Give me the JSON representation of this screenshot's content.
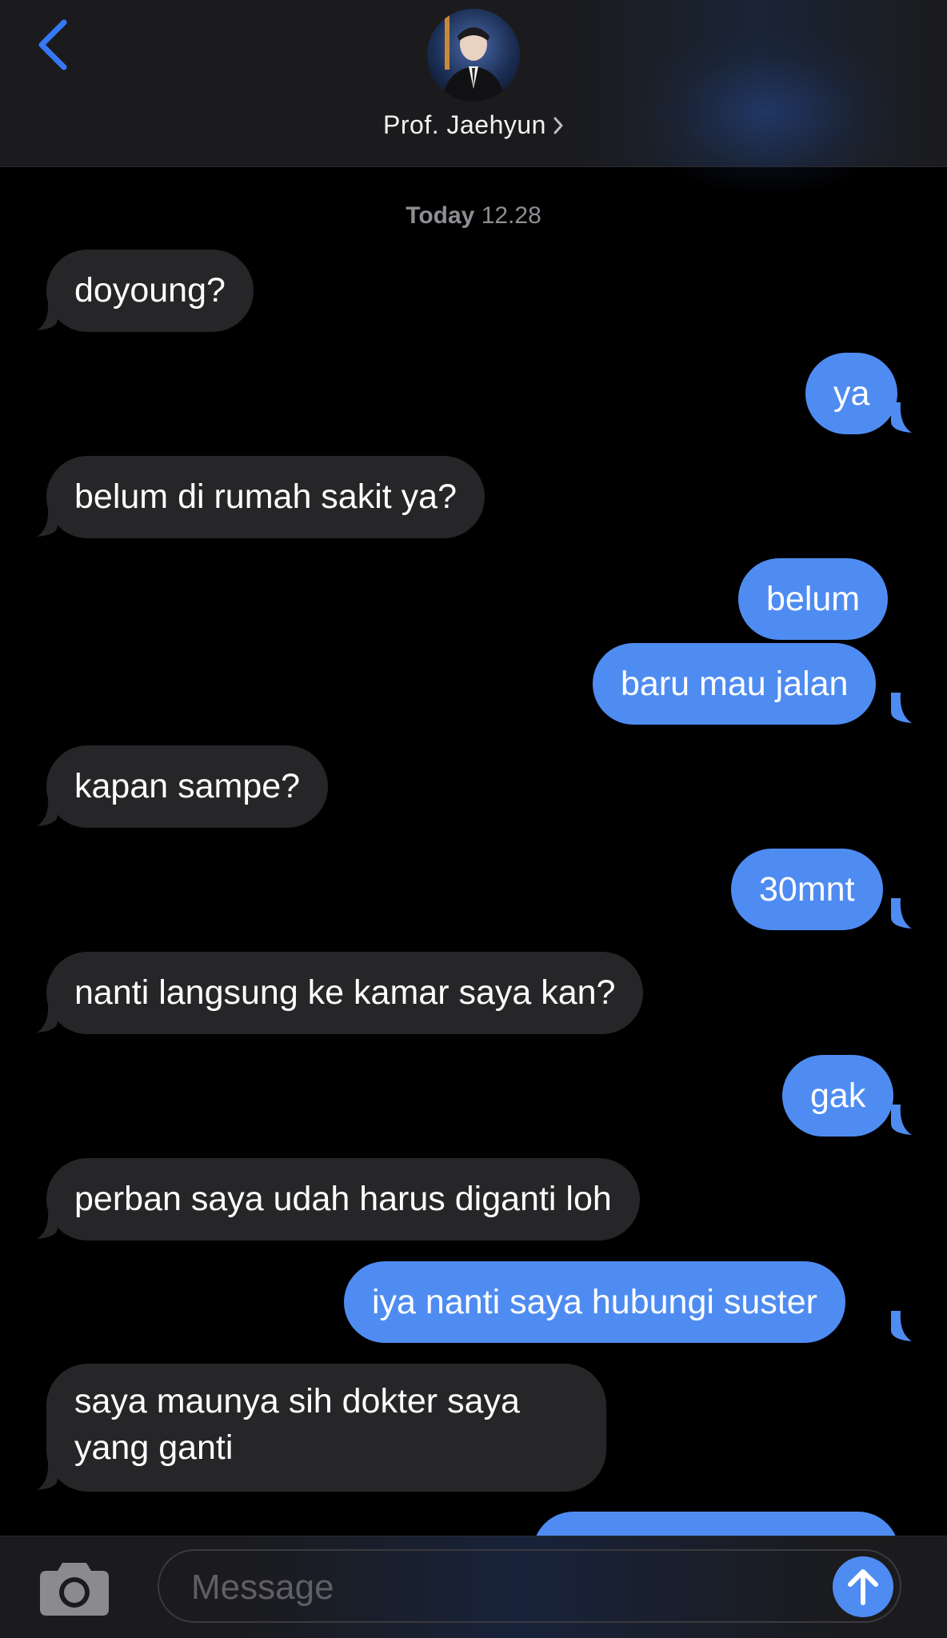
{
  "header": {
    "contact_name": "Prof. Jaehyun",
    "back_icon": "chevron-left-icon",
    "name_chevron_icon": "chevron-right-icon"
  },
  "conversation": {
    "timestamp_day": "Today",
    "timestamp_time": "12.28",
    "messages": [
      {
        "direction": "in",
        "text": "doyoung?"
      },
      {
        "direction": "out",
        "text": "ya"
      },
      {
        "direction": "in",
        "text": "belum di rumah sakit ya?"
      },
      {
        "direction": "out",
        "text": "belum"
      },
      {
        "direction": "out",
        "text": "baru mau jalan"
      },
      {
        "direction": "in",
        "text": "kapan sampe?"
      },
      {
        "direction": "out",
        "text": "30mnt"
      },
      {
        "direction": "in",
        "text": "nanti langsung ke kamar saya kan?"
      },
      {
        "direction": "out",
        "text": "gak"
      },
      {
        "direction": "in",
        "text": "perban saya udah harus diganti loh"
      },
      {
        "direction": "out",
        "text": "iya nanti saya hubungi suster"
      },
      {
        "direction": "in",
        "text": "saya maunya sih dokter saya yang ganti"
      }
    ]
  },
  "composer": {
    "placeholder": "Message",
    "camera_icon": "camera-icon",
    "send_icon": "arrow-up-icon"
  },
  "colors": {
    "incoming_bubble": "#262628",
    "outgoing_bubble": "#4f8cf2",
    "accent": "#3478f6"
  }
}
